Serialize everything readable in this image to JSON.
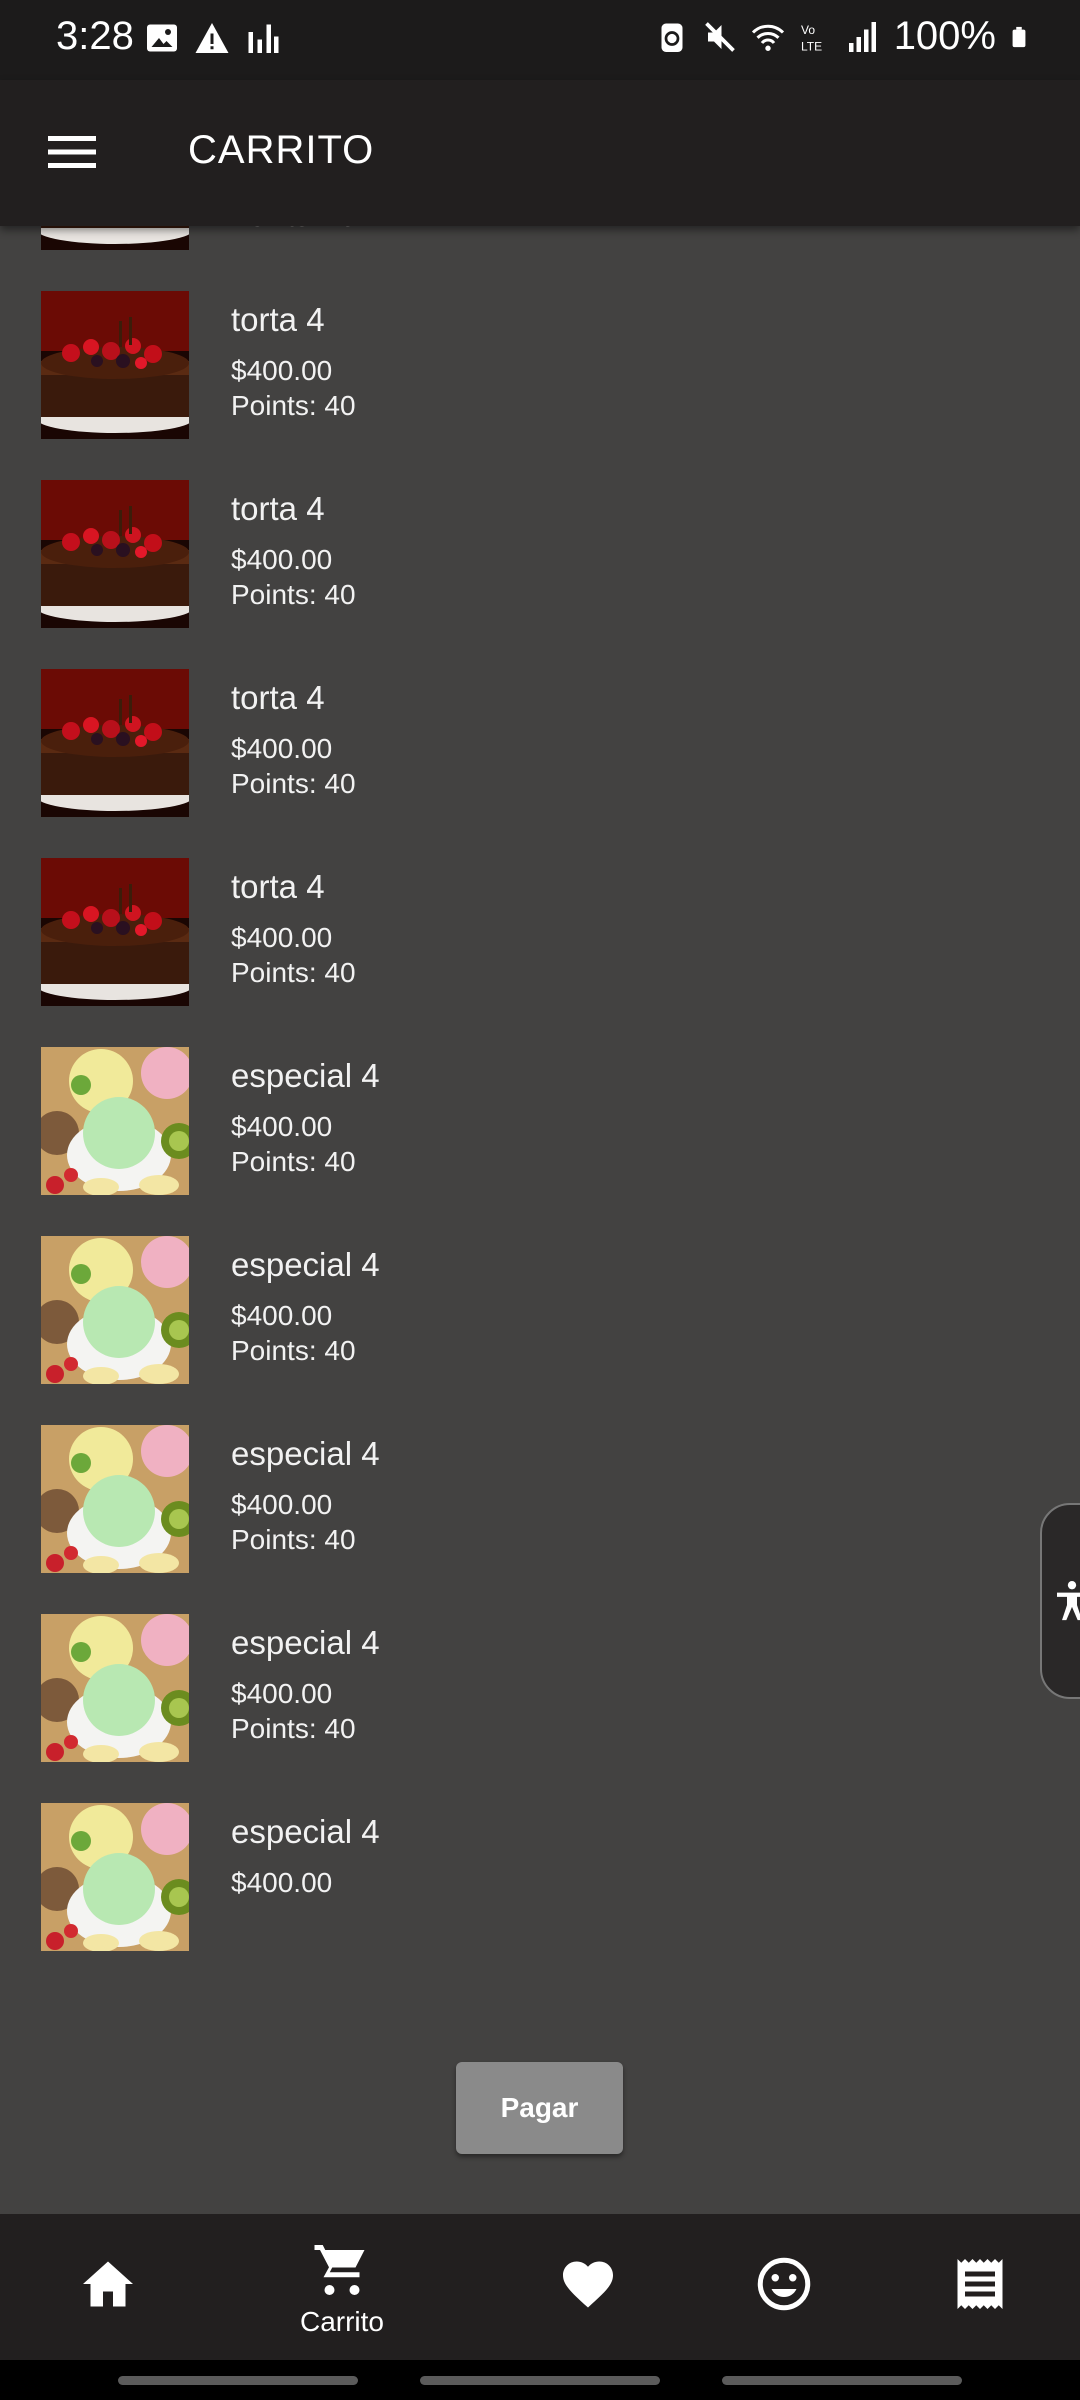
{
  "status_bar": {
    "time": "3:28",
    "battery": "100%",
    "left_icons": [
      "image-icon",
      "warning-icon",
      "bar-chart-icon"
    ],
    "right_icons": [
      "recycle-battery-icon",
      "mute-icon",
      "wifi-icon",
      "volte-icon",
      "signal-icon",
      "battery-icon"
    ]
  },
  "app_bar": {
    "title": "CARRITO",
    "menu_icon": "hamburger-menu-icon"
  },
  "cart_items": [
    {
      "name": "torta 4",
      "price": "$400.00",
      "points": "Points: 40",
      "image": "chocolate-cake"
    },
    {
      "name": "torta 4",
      "price": "$400.00",
      "points": "Points: 40",
      "image": "chocolate-cake"
    },
    {
      "name": "torta 4",
      "price": "$400.00",
      "points": "Points: 40",
      "image": "chocolate-cake"
    },
    {
      "name": "torta 4",
      "price": "$400.00",
      "points": "Points: 40",
      "image": "chocolate-cake"
    },
    {
      "name": "torta 4",
      "price": "$400.00",
      "points": "Points: 40",
      "image": "chocolate-cake"
    },
    {
      "name": "especial 4",
      "price": "$400.00",
      "points": "Points: 40",
      "image": "ice-cream"
    },
    {
      "name": "especial 4",
      "price": "$400.00",
      "points": "Points: 40",
      "image": "ice-cream"
    },
    {
      "name": "especial 4",
      "price": "$400.00",
      "points": "Points: 40",
      "image": "ice-cream"
    },
    {
      "name": "especial 4",
      "price": "$400.00",
      "points": "Points: 40",
      "image": "ice-cream"
    },
    {
      "name": "especial 4",
      "price": "$400.00",
      "points": "",
      "image": "ice-cream"
    }
  ],
  "pay_button": {
    "label": "Pagar"
  },
  "accessibility_icon": "accessibility-icon",
  "bottom_nav": [
    {
      "icon": "home-icon",
      "label": "",
      "active": false
    },
    {
      "icon": "cart-icon",
      "label": "Carrito",
      "active": true
    },
    {
      "icon": "heart-icon",
      "label": "",
      "active": false
    },
    {
      "icon": "smiley-icon",
      "label": "",
      "active": false
    },
    {
      "icon": "receipt-icon",
      "label": "",
      "active": false
    }
  ],
  "colors": {
    "background": "#434241",
    "app_bar": "#221f1f",
    "status_bar": "#1c1b1b",
    "pay_button": "#8a8a8a",
    "text": "#ffffff"
  }
}
